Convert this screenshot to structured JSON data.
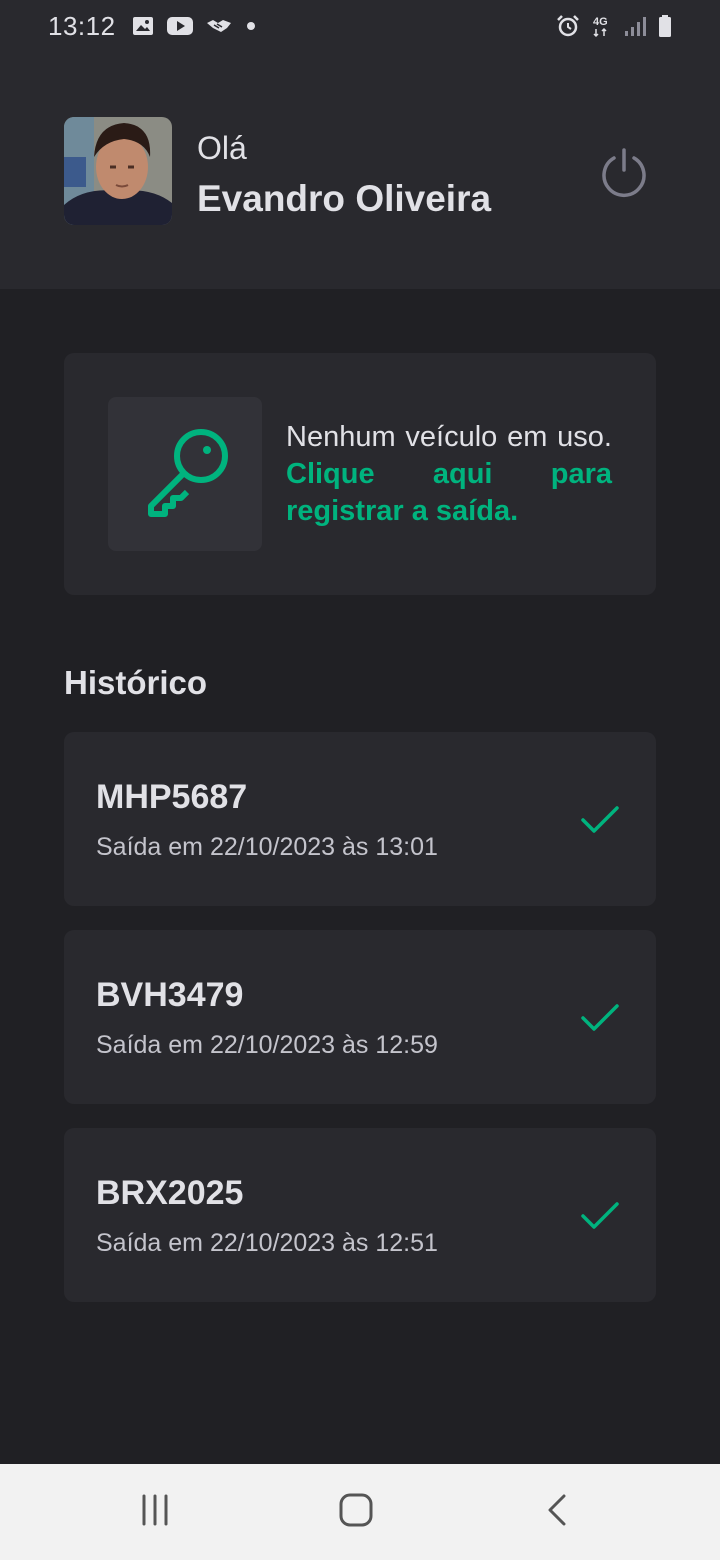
{
  "status_bar": {
    "time": "13:12",
    "left_icons": [
      "image-icon",
      "youtube-icon",
      "handshake-icon",
      "dot-icon"
    ],
    "right_icons": [
      "alarm-icon",
      "4g-icon",
      "signal-icon",
      "battery-icon"
    ],
    "network_label": "4G"
  },
  "header": {
    "greeting": "Olá",
    "user_name": "Evandro Oliveira",
    "avatar_icon": "avatar",
    "logout_icon": "power-icon"
  },
  "vehicle_card": {
    "icon": "key-icon",
    "message": "Nenhum veículo em uso.",
    "link_text": "Clique aqui para registrar a saída."
  },
  "history": {
    "title": "Histórico",
    "items": [
      {
        "plate": "MHP5687",
        "departure": "Saída em 22/10/2023 às 13:01",
        "icon": "check-icon"
      },
      {
        "plate": "BVH3479",
        "departure": "Saída em 22/10/2023 às 12:59",
        "icon": "check-icon"
      },
      {
        "plate": "BRX2025",
        "departure": "Saída em 22/10/2023 às 12:51",
        "icon": "check-icon"
      }
    ]
  },
  "nav_bar": {
    "buttons": [
      "recent-apps-icon",
      "home-icon",
      "back-icon"
    ]
  },
  "colors": {
    "accent": "#00B37E",
    "background": "#202024",
    "surface": "#29292E",
    "surface_alt": "#323238",
    "text": "#E1E1E6",
    "muted_text": "#C4C4CC",
    "icon_gray": "#7C7C8A"
  }
}
